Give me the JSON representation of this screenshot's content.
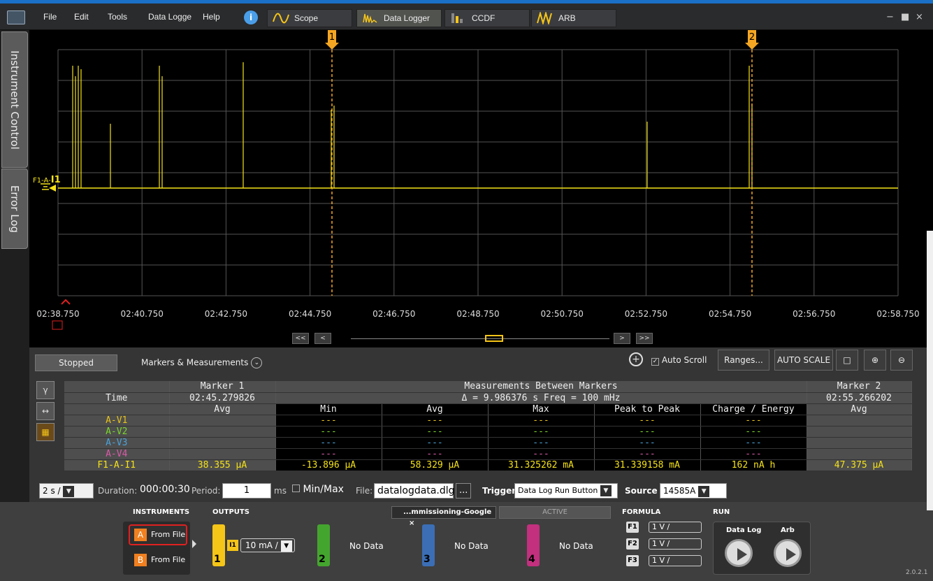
{
  "menu": {
    "items": [
      "File",
      "Edit",
      "Tools",
      "Data Logge",
      "Help"
    ]
  },
  "tabs": [
    {
      "label": "Scope"
    },
    {
      "label": "Data Logger"
    },
    {
      "label": "CCDF"
    },
    {
      "label": "ARB"
    }
  ],
  "window_controls": {
    "minimize": "−",
    "maximize": "■",
    "close": "×"
  },
  "side_tabs": {
    "instrument_control": "Instrument Control",
    "error_log": "Error Log"
  },
  "plot": {
    "time_ticks": [
      "02:38.750",
      "02:40.750",
      "02:42.750",
      "02:44.750",
      "02:46.750",
      "02:48.750",
      "02:50.750",
      "02:52.750",
      "02:54.750",
      "02:56.750",
      "02:58.750"
    ],
    "trace_label": "F1-A-",
    "trace_label_bold": "I1",
    "trace_color": "#f5e218",
    "marker_color": "#f5a623",
    "marker1_label": "1",
    "marker2_label": "2"
  },
  "nav": {
    "fast_back": "<<",
    "back": "<",
    "fwd": ">",
    "fast_fwd": ">>"
  },
  "status": "Stopped",
  "markers_measurements_label": "Markers & Measurements",
  "toolbar": {
    "auto_scroll": "Auto Scroll",
    "ranges": "Ranges...",
    "auto_scale": "AUTO SCALE"
  },
  "table": {
    "marker1_header": "Marker 1",
    "between_header": "Measurements Between Markers",
    "marker2_header": "Marker 2",
    "time_label": "Time",
    "marker1_time": "02:45.279826",
    "delta": "Δ = 9.986376 s   Freq = 100 mHz",
    "marker2_time": "02:55.266202",
    "columns": [
      "Avg",
      "Min",
      "Avg",
      "Max",
      "Peak to Peak",
      "Charge / Energy",
      "Avg"
    ],
    "rows": [
      {
        "name": "A-V1",
        "color": "#e7c21b",
        "cells": [
          "",
          "---",
          "---",
          "---",
          "---",
          "---",
          ""
        ]
      },
      {
        "name": "A-V2",
        "color": "#7bd62b",
        "cells": [
          "",
          "---",
          "---",
          "---",
          "---",
          "---",
          ""
        ]
      },
      {
        "name": "A-V3",
        "color": "#4aa3d9",
        "cells": [
          "",
          "---",
          "---",
          "---",
          "---",
          "---",
          ""
        ]
      },
      {
        "name": "A-V4",
        "color": "#d95ba8",
        "cells": [
          "",
          "---",
          "---",
          "---",
          "---",
          "---",
          ""
        ]
      },
      {
        "name": "F1-A-I1",
        "color": "#f5e218",
        "cells": [
          "38.355 µA",
          "-13.896 µA",
          "58.329 µA",
          "31.325262 mA",
          "31.339158 mA",
          "162 nA h",
          "47.375 µA"
        ]
      }
    ]
  },
  "bottom": {
    "timebase": "2 s /",
    "duration_label": "Duration:",
    "duration": "000:00:30",
    "period_label": "Period:",
    "period": "1",
    "period_unit": "ms",
    "minmax_label": "Min/Max",
    "file_label": "File:",
    "file": "datalogdata.dlg",
    "file_browse": "...",
    "trigger_label": "Trigger",
    "trigger": "Data Log Run Button",
    "source_label": "Source",
    "source": "14585A"
  },
  "dock": {
    "instruments_label": "INSTRUMENTS",
    "outputs_label": "OUTPUTS",
    "formula_label": "FORMULA",
    "run_label": "RUN",
    "inst_a_badge": "A",
    "inst_a": "From File",
    "inst_b_badge": "B",
    "inst_b": "From File",
    "tab_commissioning": "...mmissioning-Google",
    "tab_close": "×",
    "tab_active": "ACTIVE",
    "ch1": "1",
    "ch1_badge": "I1",
    "ch1_scale": "10 mA /",
    "ch2": "2",
    "ch3": "3",
    "ch4": "4",
    "no_data": "No Data",
    "f1": "F1",
    "f2": "F2",
    "f3": "F3",
    "fscale": "1 V /",
    "run_datalog": "Data Log",
    "run_arb": "Arb",
    "version": "2.0.2.1"
  }
}
